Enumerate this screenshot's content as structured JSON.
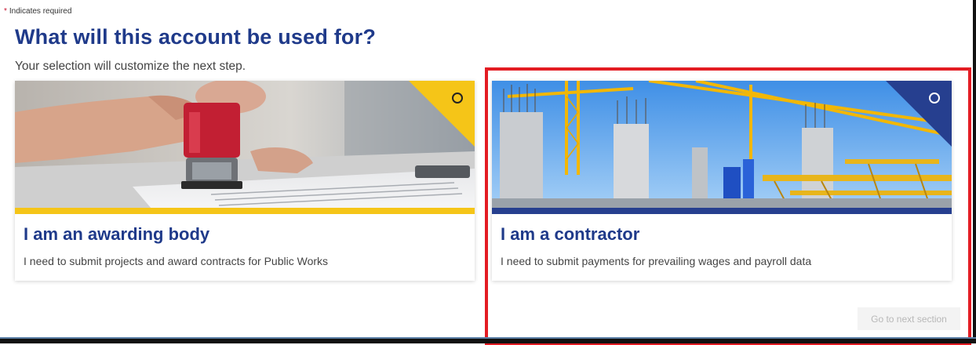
{
  "form": {
    "required_marker": "*",
    "required_note": "Indicates required",
    "title": "What will this account be used for?",
    "subtitle": "Your selection will customize the next step."
  },
  "options": [
    {
      "title": "I am an awarding body",
      "description": "I need to submit projects and award contracts for Public Works",
      "accent_color": "#f5c518",
      "selected": false
    },
    {
      "title": "I am a contractor",
      "description": "I need to submit payments for prevailing wages and payroll data",
      "accent_color": "#263f8f",
      "selected": false
    }
  ],
  "actions": {
    "next_label": "Go to next section",
    "next_enabled": false
  },
  "colors": {
    "heading": "#1f3a8a",
    "highlight": "#e31c23"
  }
}
